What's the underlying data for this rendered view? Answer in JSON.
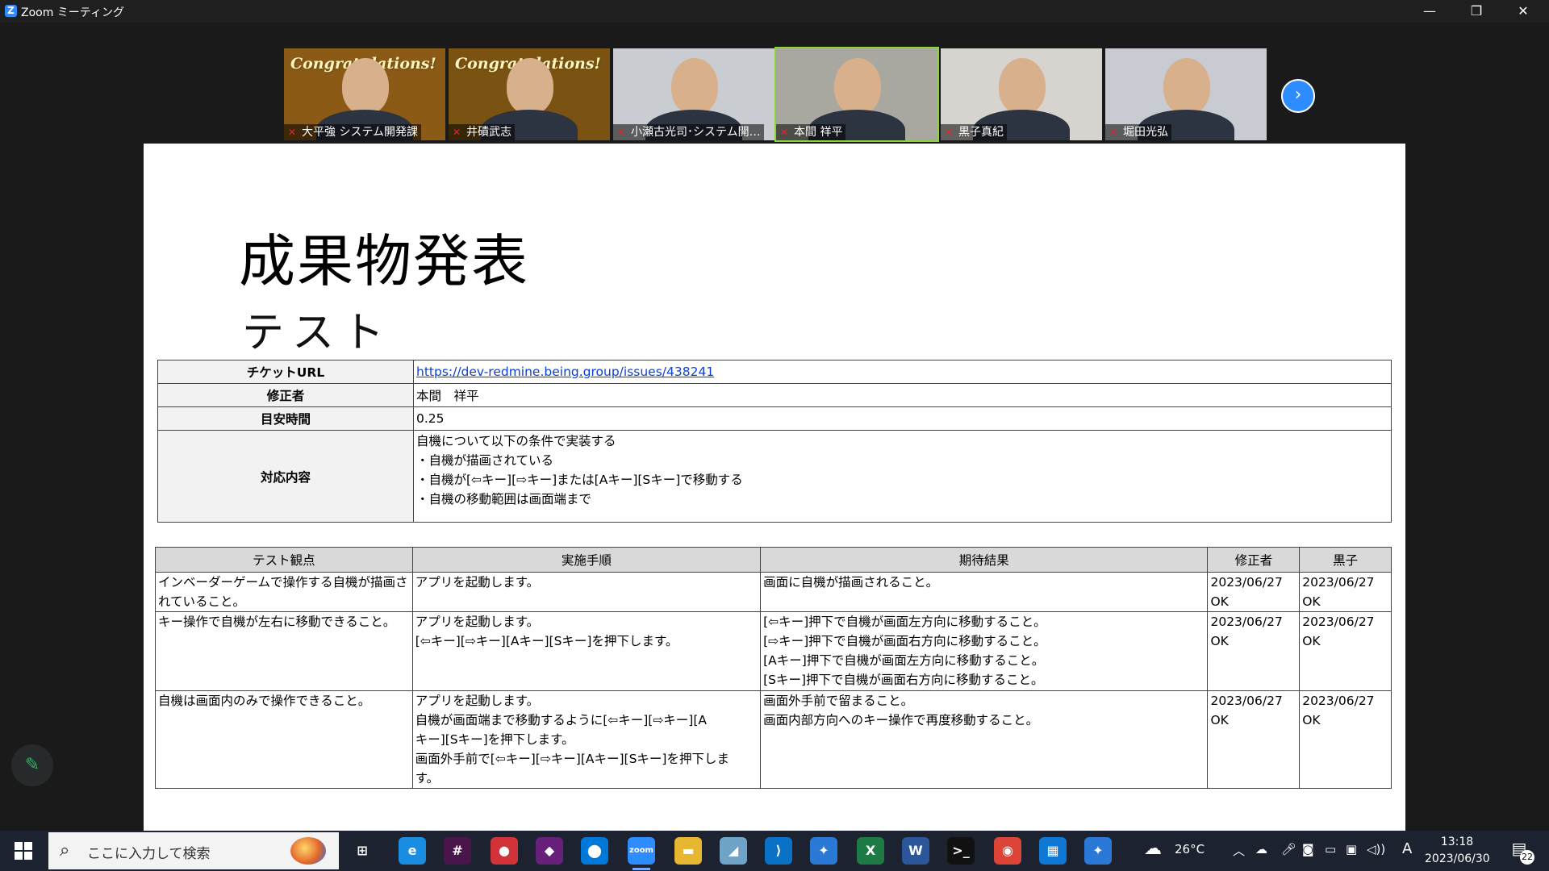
{
  "window": {
    "title": "Zoom ミーティング",
    "logo": "Z",
    "minimize": "—",
    "restore": "❐",
    "close": "✕"
  },
  "participants": [
    {
      "name": "大平強 システム開発課",
      "banner": "Congratulations!",
      "bg": "#8a5a16"
    },
    {
      "name": "井磧武志",
      "banner": "Congratulations!",
      "bg": "#7a5212"
    },
    {
      "name": "小瀬古光司･システム開…",
      "banner": "",
      "bg": "#c9ccd0"
    },
    {
      "name": "本間 祥平",
      "banner": "",
      "bg": "#a8a8a0"
    },
    {
      "name": "黒子真紀",
      "banner": "",
      "bg": "#d7d4d0"
    },
    {
      "name": "堀田光弘",
      "banner": "",
      "bg": "#c8ccd2"
    }
  ],
  "next_arrow": "›",
  "slide": {
    "title": "成果物発表",
    "subtitle": "テスト",
    "info": {
      "ticket_label": "チケットURL",
      "ticket_url": "https://dev-redmine.being.group/issues/438241",
      "editor_label": "修正者",
      "editor": "本間　祥平",
      "time_label": "目安時間",
      "time": "0.25",
      "content_label": "対応内容",
      "content_lines": [
        "自機について以下の条件で実装する",
        "・自機が描画されている",
        "・自機が[⇦キー][⇨キー]または[Aキー][Sキー]で移動する",
        "・自機の移動範囲は画面端まで"
      ]
    },
    "tests": {
      "headers": [
        "テスト観点",
        "実施手順",
        "期待結果",
        "修正者",
        "黒子"
      ],
      "rows": [
        {
          "viewpoint": [
            "インベーダーゲームで操作する自機が描画さ",
            "れていること。"
          ],
          "steps": [
            "アプリを起動します。"
          ],
          "expected": [
            "画面に自機が描画されること。"
          ],
          "editor": [
            "2023/06/27",
            "OK"
          ],
          "kuroko": [
            "2023/06/27",
            "OK"
          ]
        },
        {
          "viewpoint": [
            "キー操作で自機が左右に移動できること。"
          ],
          "steps": [
            "アプリを起動します。",
            "[⇦キー][⇨キー][Aキー][Sキー]を押下します。"
          ],
          "expected": [
            "[⇦キー]押下で自機が画面左方向に移動すること。",
            "[⇨キー]押下で自機が画面右方向に移動すること。",
            "[Aキー]押下で自機が画面左方向に移動すること。",
            "[Sキー]押下で自機が画面右方向に移動すること。"
          ],
          "editor": [
            "2023/06/27",
            "OK"
          ],
          "kuroko": [
            "2023/06/27",
            "OK"
          ]
        },
        {
          "viewpoint": [
            "自機は画面内のみで操作できること。"
          ],
          "steps": [
            "アプリを起動します。",
            "自機が画面端まで移動するように[⇦キー][⇨キー][A",
            "キー][Sキー]を押下します。",
            "画面外手前で[⇦キー][⇨キー][Aキー][Sキー]を押下しま",
            "す。"
          ],
          "expected": [
            "画面外手前で留まること。",
            "画面内部方向へのキー操作で再度移動すること。"
          ],
          "editor": [
            "2023/06/27",
            "OK"
          ],
          "kuroko": [
            "2023/06/27",
            "OK"
          ]
        }
      ]
    }
  },
  "annotate_icon": "✎",
  "taskbar": {
    "search_placeholder": "ここに入力して検索",
    "apps": [
      {
        "name": "task-view-icon",
        "glyph": "⊞",
        "color": "#1c2230"
      },
      {
        "name": "edge-icon",
        "glyph": "e",
        "color": "#1b8de0"
      },
      {
        "name": "slack-icon",
        "glyph": "#",
        "color": "#4a154b"
      },
      {
        "name": "teams-chat-icon",
        "glyph": "●",
        "color": "#d13438"
      },
      {
        "name": "visual-studio-icon",
        "glyph": "◆",
        "color": "#68217a"
      },
      {
        "name": "maps-icon",
        "glyph": "⬤",
        "color": "#0078d7"
      },
      {
        "name": "zoom-icon",
        "glyph": "zoom",
        "color": "#2d8cff"
      },
      {
        "name": "file-explorer-icon",
        "glyph": "▬",
        "color": "#e8b731"
      },
      {
        "name": "notes-icon",
        "glyph": "◢",
        "color": "#6fa3c7"
      },
      {
        "name": "vscode-icon",
        "glyph": "⟩",
        "color": "#0a72c6"
      },
      {
        "name": "app-bird-icon",
        "glyph": "✦",
        "color": "#2b79d6"
      },
      {
        "name": "excel-icon",
        "glyph": "X",
        "color": "#1d7a45"
      },
      {
        "name": "word-icon",
        "glyph": "W",
        "color": "#2b579a"
      },
      {
        "name": "terminal-icon",
        "glyph": ">_",
        "color": "#111111"
      },
      {
        "name": "chrome-icon",
        "glyph": "◉",
        "color": "#db4437"
      },
      {
        "name": "calendar-icon",
        "glyph": "▦",
        "color": "#0f78d4"
      },
      {
        "name": "app-bird2-icon",
        "glyph": "✦",
        "color": "#2b79d6"
      }
    ],
    "weather": "26°C",
    "ime": "A",
    "time": "13:18",
    "date": "2023/06/30",
    "notifications": "22"
  }
}
